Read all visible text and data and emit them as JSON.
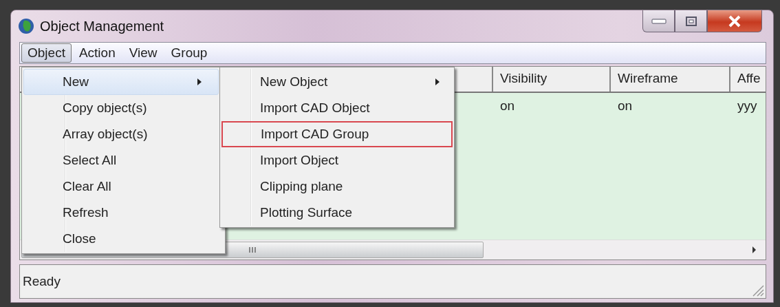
{
  "window": {
    "title": "Object Management"
  },
  "menu_bar": [
    {
      "label": "Object",
      "selected": true
    },
    {
      "label": "Action",
      "selected": false
    },
    {
      "label": "View",
      "selected": false
    },
    {
      "label": "Group",
      "selected": false
    }
  ],
  "table": {
    "columns": [
      {
        "label": "Visibility"
      },
      {
        "label": "Wireframe"
      },
      {
        "label": "Affe"
      }
    ],
    "rows": [
      {
        "cells": [
          "on",
          "on",
          "yyy"
        ]
      }
    ]
  },
  "menu": {
    "items": [
      {
        "label": "New",
        "has_submenu": true,
        "selected": true
      },
      {
        "label": "Copy object(s)",
        "has_submenu": false,
        "selected": false
      },
      {
        "label": "Array object(s)",
        "has_submenu": false,
        "selected": false
      },
      {
        "label": "Select All",
        "has_submenu": false,
        "selected": false
      },
      {
        "label": "Clear All",
        "has_submenu": false,
        "selected": false
      },
      {
        "label": "Refresh",
        "has_submenu": false,
        "selected": false
      },
      {
        "label": "Close",
        "has_submenu": false,
        "selected": false
      }
    ]
  },
  "submenu": {
    "items": [
      {
        "label": "New Object",
        "has_submenu": true,
        "highlighted": false
      },
      {
        "label": "Import CAD Object",
        "has_submenu": false,
        "highlighted": false
      },
      {
        "label": "Import CAD Group",
        "has_submenu": false,
        "highlighted": true
      },
      {
        "label": "Import Object",
        "has_submenu": false,
        "highlighted": false
      },
      {
        "label": "Clipping plane",
        "has_submenu": false,
        "highlighted": false
      },
      {
        "label": "Plotting Surface",
        "has_submenu": false,
        "highlighted": false
      }
    ]
  },
  "status_bar": {
    "text": "Ready"
  }
}
